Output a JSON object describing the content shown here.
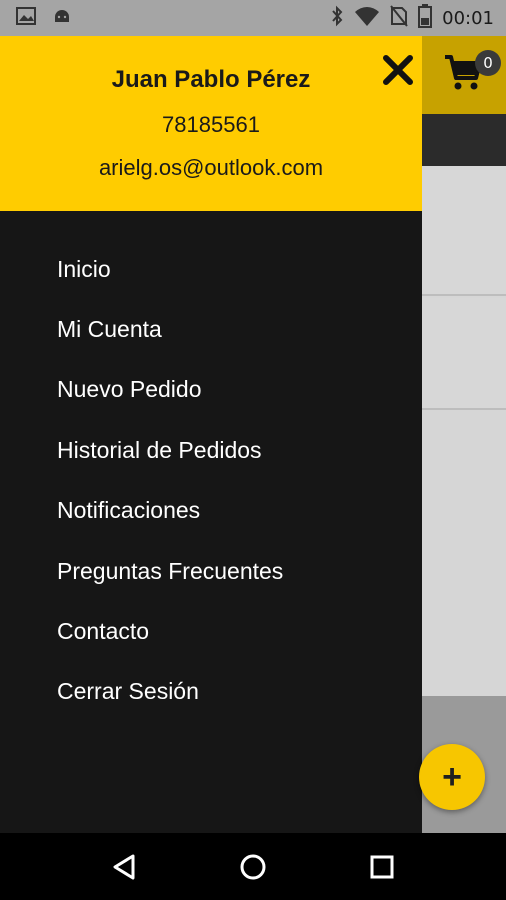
{
  "status_bar": {
    "time": "00:01",
    "icons": [
      "image-icon",
      "android-icon",
      "bluetooth-icon",
      "wifi-icon",
      "no-sim-icon",
      "battery-icon"
    ]
  },
  "drawer": {
    "user_name": "Juan Pablo Pérez",
    "phone": "78185561",
    "email": "arielg.os@outlook.com",
    "menu": [
      {
        "label": "Inicio"
      },
      {
        "label": "Mi Cuenta"
      },
      {
        "label": "Nuevo Pedido"
      },
      {
        "label": "Historial de Pedidos"
      },
      {
        "label": "Notificaciones"
      },
      {
        "label": "Preguntas Frecuentes"
      },
      {
        "label": "Contacto"
      },
      {
        "label": "Cerrar Sesión"
      }
    ]
  },
  "app_bar": {
    "cart_count": "0",
    "fab_label": "+"
  },
  "colors": {
    "accent": "#ffcc00",
    "drawer_bg": "#161616",
    "text_on_accent": "#1a1a1a"
  },
  "navigation_bar": {
    "buttons": [
      "back-icon",
      "home-icon",
      "recents-icon"
    ]
  }
}
